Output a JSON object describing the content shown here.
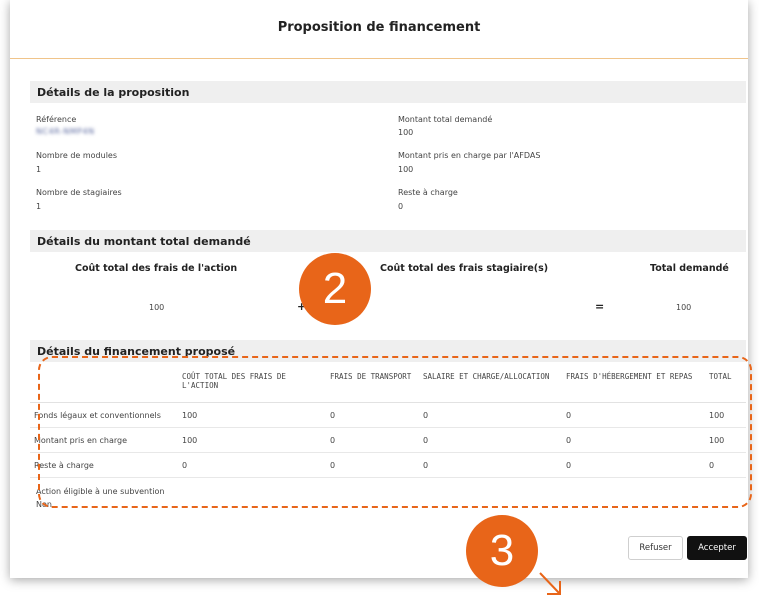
{
  "modal": {
    "title": "Proposition de financement"
  },
  "details": {
    "heading": "Détails de la proposition",
    "reference_label": "Référence",
    "reference_value": "NC4R-NMP4N",
    "modules_label": "Nombre de modules",
    "modules_value": "1",
    "trainees_label": "Nombre de stagiaires",
    "trainees_value": "1",
    "total_requested_label": "Montant total demandé",
    "total_requested_value": "100",
    "afdas_label": "Montant pris en charge par l'AFDAS",
    "afdas_value": "100",
    "remaining_label": "Reste à charge",
    "remaining_value": "0"
  },
  "amount": {
    "heading": "Détails du montant total demandé",
    "action_cost_label": "Coût total des frais de l'action",
    "action_cost_value": "100",
    "plus": "+",
    "trainee_cost_label": "Coût total des frais stagiaire(s)",
    "equals": "=",
    "total_label": "Total demandé",
    "total_value": "100"
  },
  "financing": {
    "heading": "Détails du financement proposé",
    "columns": [
      "",
      "COÛT TOTAL DES FRAIS DE L'ACTION",
      "FRAIS DE TRANSPORT",
      "SALAIRE ET CHARGE/ALLOCATION",
      "FRAIS D'HÉBERGEMENT ET REPAS",
      "TOTAL"
    ],
    "rows": [
      [
        "Fonds légaux et conventionnels",
        "100",
        "0",
        "0",
        "0",
        "100"
      ],
      [
        "Montant pris en charge",
        "100",
        "0",
        "0",
        "0",
        "100"
      ],
      [
        "Reste à charge",
        "0",
        "0",
        "0",
        "0",
        "0"
      ]
    ],
    "subsidy_label": "Action éligible à une subvention",
    "subsidy_value": "Non"
  },
  "annotations": {
    "badge_2": "2",
    "badge_3": "3",
    "accent_color": "#e86519"
  },
  "buttons": {
    "refuse": "Refuser",
    "accept": "Accepter"
  }
}
